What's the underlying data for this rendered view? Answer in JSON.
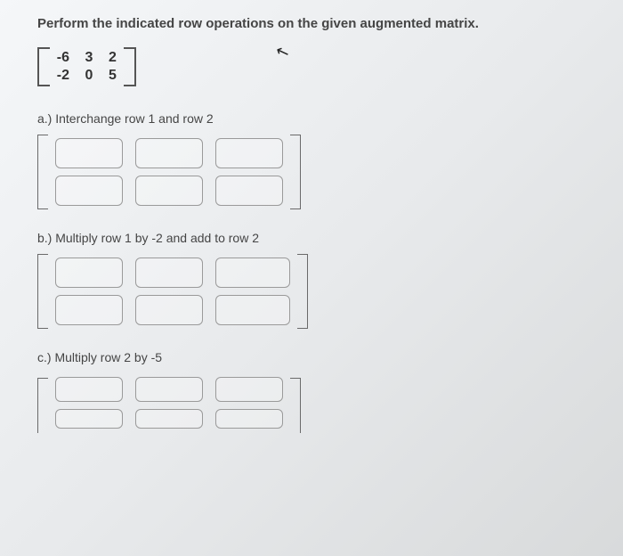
{
  "heading": "Perform the indicated row operations on the given augmented matrix.",
  "cursor_glyph": "↖",
  "given_matrix": {
    "r1": {
      "c1": "-6",
      "c2": "3",
      "c3": "2"
    },
    "r2": {
      "c1": "-2",
      "c2": "0",
      "c3": "5"
    }
  },
  "parts": {
    "a": {
      "label": "a.) Interchange row 1 and row 2"
    },
    "b": {
      "label": "b.) Multiply row 1 by -2 and add to row 2"
    },
    "c": {
      "label": "c.) Multiply row 2 by -5"
    }
  }
}
